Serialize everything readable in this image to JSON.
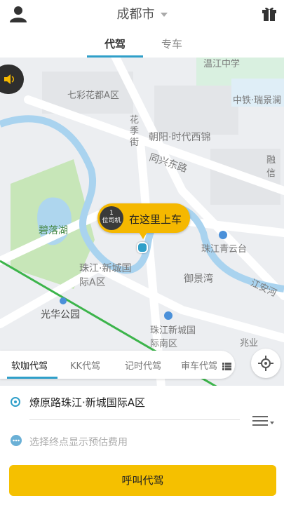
{
  "header": {
    "city": "成都市"
  },
  "tabs": [
    {
      "label": "代驾"
    },
    {
      "label": "专车"
    }
  ],
  "map": {
    "places": [
      "七彩花都A区",
      "温江中学",
      "中铁·瑞景澜",
      "朝阳·时代西锦",
      "融信",
      "碧落湖",
      "珠江青云台",
      "珠江·新城国际A区",
      "御景湾",
      "光华公园",
      "珠江新城国际南区",
      "兆业"
    ],
    "roads": [
      "花季街",
      "同兴东路",
      "江安河"
    ],
    "pickup": {
      "driver_count": "1",
      "driver_unit": "位司机",
      "label": "在这里上车"
    }
  },
  "services": [
    {
      "label": "软咖代驾"
    },
    {
      "label": "KK代驾"
    },
    {
      "label": "记时代驾"
    },
    {
      "label": "审车代驾"
    }
  ],
  "trip": {
    "start": "燎原路珠江·新城国际A区",
    "end_placeholder": "选择终点显示预估费用"
  },
  "action": {
    "label": "呼叫代驾"
  },
  "colors": {
    "accent": "#2f9fc9",
    "brand": "#f5c000"
  }
}
